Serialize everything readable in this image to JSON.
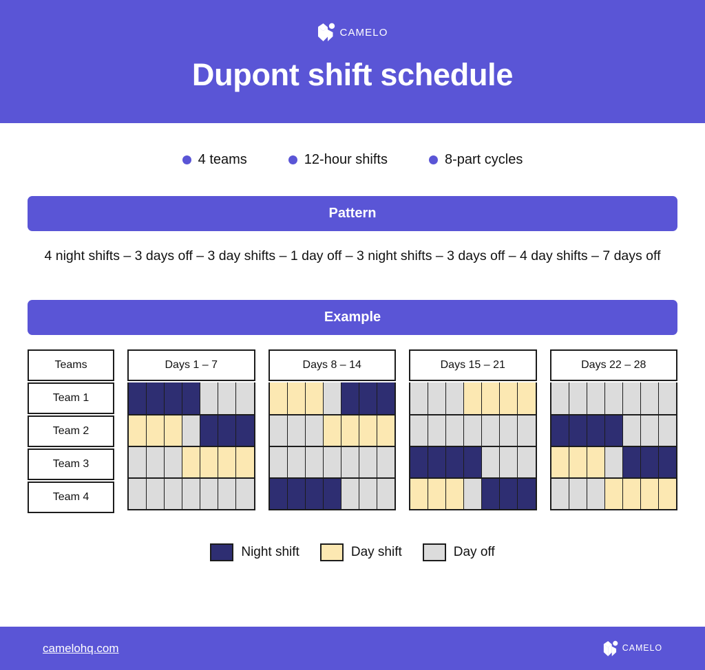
{
  "brand": {
    "name": "CAMELO",
    "logo_icon": "camelo-logo-icon",
    "accent_color": "#5A55D6"
  },
  "header": {
    "title": "Dupont shift schedule"
  },
  "features": [
    {
      "label": "4 teams",
      "icon": "bullet-dot-icon"
    },
    {
      "label": "12-hour shifts",
      "icon": "bullet-dot-icon"
    },
    {
      "label": "8-part cycles",
      "icon": "bullet-dot-icon"
    }
  ],
  "pattern": {
    "banner_label": "Pattern",
    "text": "4 night shifts – 3 days off – 3 day shifts – 1 day off – 3 night shifts – 3 days off – 4 day shifts – 7 days off"
  },
  "example": {
    "banner_label": "Example",
    "teams_header": "Teams",
    "teams": [
      "Team 1",
      "Team 2",
      "Team 3",
      "Team 4"
    ],
    "weeks": [
      {
        "label": "Days 1 – 7"
      },
      {
        "label": "Days 8 – 14"
      },
      {
        "label": "Days 15 – 21"
      },
      {
        "label": "Days 22 – 28"
      }
    ]
  },
  "legend": [
    {
      "label": "Night shift",
      "code": "N",
      "color": "#2E2E72"
    },
    {
      "label": "Day shift",
      "code": "D",
      "color": "#FCE8B2"
    },
    {
      "label": "Day off",
      "code": "O",
      "color": "#DCDCDC"
    }
  ],
  "footer": {
    "url": "camelohq.com"
  },
  "chart_data": {
    "type": "heatmap",
    "title": "Dupont shift schedule",
    "xlabel": "Days",
    "ylabel": "Teams",
    "legend_position": "bottom",
    "grid": true,
    "categories_x": [
      "Days 1 – 7",
      "Days 8 – 14",
      "Days 15 – 21",
      "Days 22 – 28"
    ],
    "categories_y": [
      "Team 1",
      "Team 2",
      "Team 3",
      "Team 4"
    ],
    "value_map": {
      "N": "Night shift",
      "D": "Day shift",
      "O": "Day off"
    },
    "color_map": {
      "N": "#2E2E72",
      "D": "#FCE8B2",
      "O": "#DCDCDC"
    },
    "weeks": [
      {
        "label": "Days 1 – 7",
        "rows": [
          [
            "N",
            "N",
            "N",
            "N",
            "O",
            "O",
            "O"
          ],
          [
            "D",
            "D",
            "D",
            "O",
            "N",
            "N",
            "N"
          ],
          [
            "O",
            "O",
            "O",
            "D",
            "D",
            "D",
            "D"
          ],
          [
            "O",
            "O",
            "O",
            "O",
            "O",
            "O",
            "O"
          ]
        ]
      },
      {
        "label": "Days 8 – 14",
        "rows": [
          [
            "D",
            "D",
            "D",
            "O",
            "N",
            "N",
            "N"
          ],
          [
            "O",
            "O",
            "O",
            "D",
            "D",
            "D",
            "D"
          ],
          [
            "O",
            "O",
            "O",
            "O",
            "O",
            "O",
            "O"
          ],
          [
            "N",
            "N",
            "N",
            "N",
            "O",
            "O",
            "O"
          ]
        ]
      },
      {
        "label": "Days 15 – 21",
        "rows": [
          [
            "O",
            "O",
            "O",
            "D",
            "D",
            "D",
            "D"
          ],
          [
            "O",
            "O",
            "O",
            "O",
            "O",
            "O",
            "O"
          ],
          [
            "N",
            "N",
            "N",
            "N",
            "O",
            "O",
            "O"
          ],
          [
            "D",
            "D",
            "D",
            "O",
            "N",
            "N",
            "N"
          ]
        ]
      },
      {
        "label": "Days 22 – 28",
        "rows": [
          [
            "O",
            "O",
            "O",
            "O",
            "O",
            "O",
            "O"
          ],
          [
            "N",
            "N",
            "N",
            "N",
            "O",
            "O",
            "O"
          ],
          [
            "D",
            "D",
            "D",
            "O",
            "N",
            "N",
            "N"
          ],
          [
            "O",
            "O",
            "O",
            "D",
            "D",
            "D",
            "D"
          ]
        ]
      }
    ]
  }
}
